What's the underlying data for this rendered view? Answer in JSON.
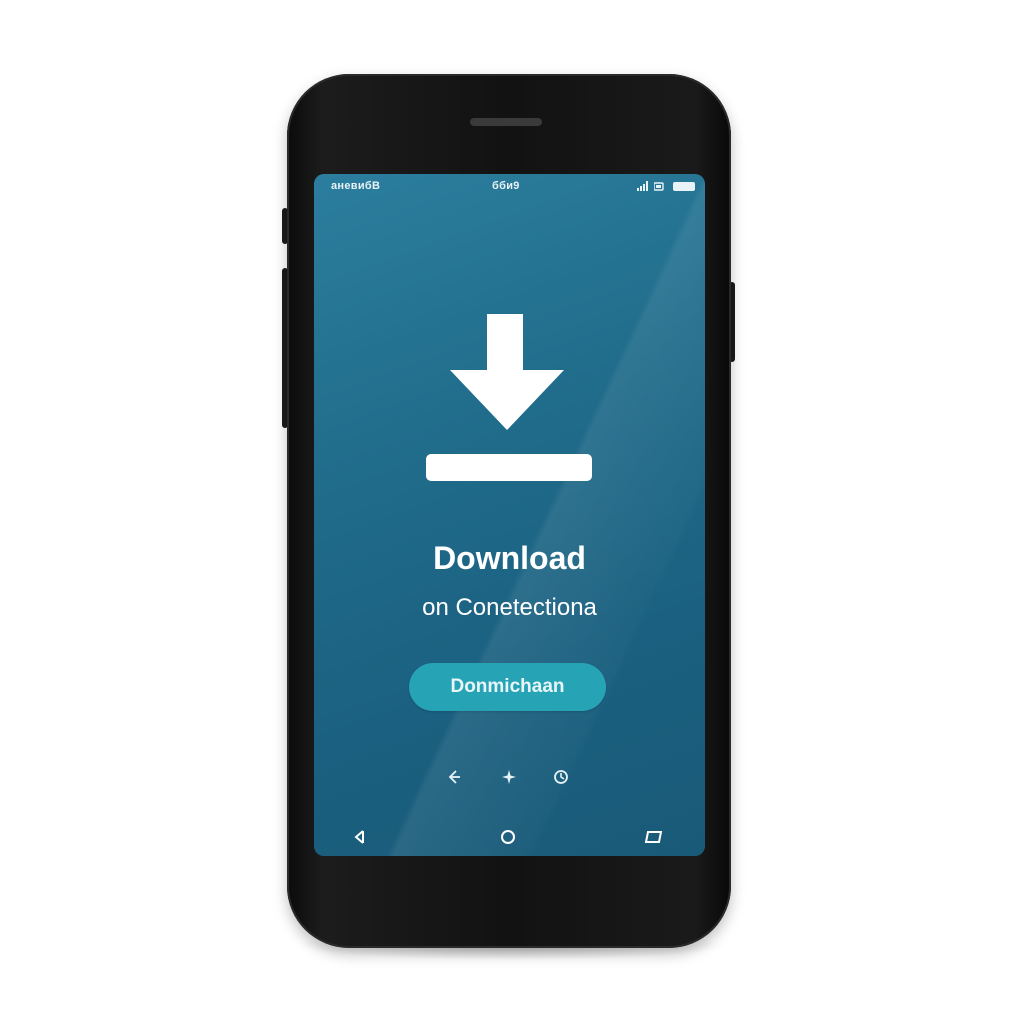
{
  "status_bar": {
    "left_text": "аневибВ",
    "time": "бби9",
    "icons": [
      "signal-icon",
      "wifi-icon",
      "battery-icon"
    ]
  },
  "hero": {
    "icon": "download-icon",
    "title": "Download",
    "subtitle": "on Conetectiona"
  },
  "primary_button": {
    "label": "Donmichaan"
  },
  "quick_actions": [
    "share-icon",
    "sparkle-icon",
    "refresh-icon"
  ],
  "nav_bar": [
    "back-icon",
    "home-icon",
    "recents-icon"
  ],
  "colors": {
    "screen_top": "#2c7e9e",
    "screen_bottom": "#195a78",
    "button": "#27a3b6",
    "text": "#ffffff"
  }
}
